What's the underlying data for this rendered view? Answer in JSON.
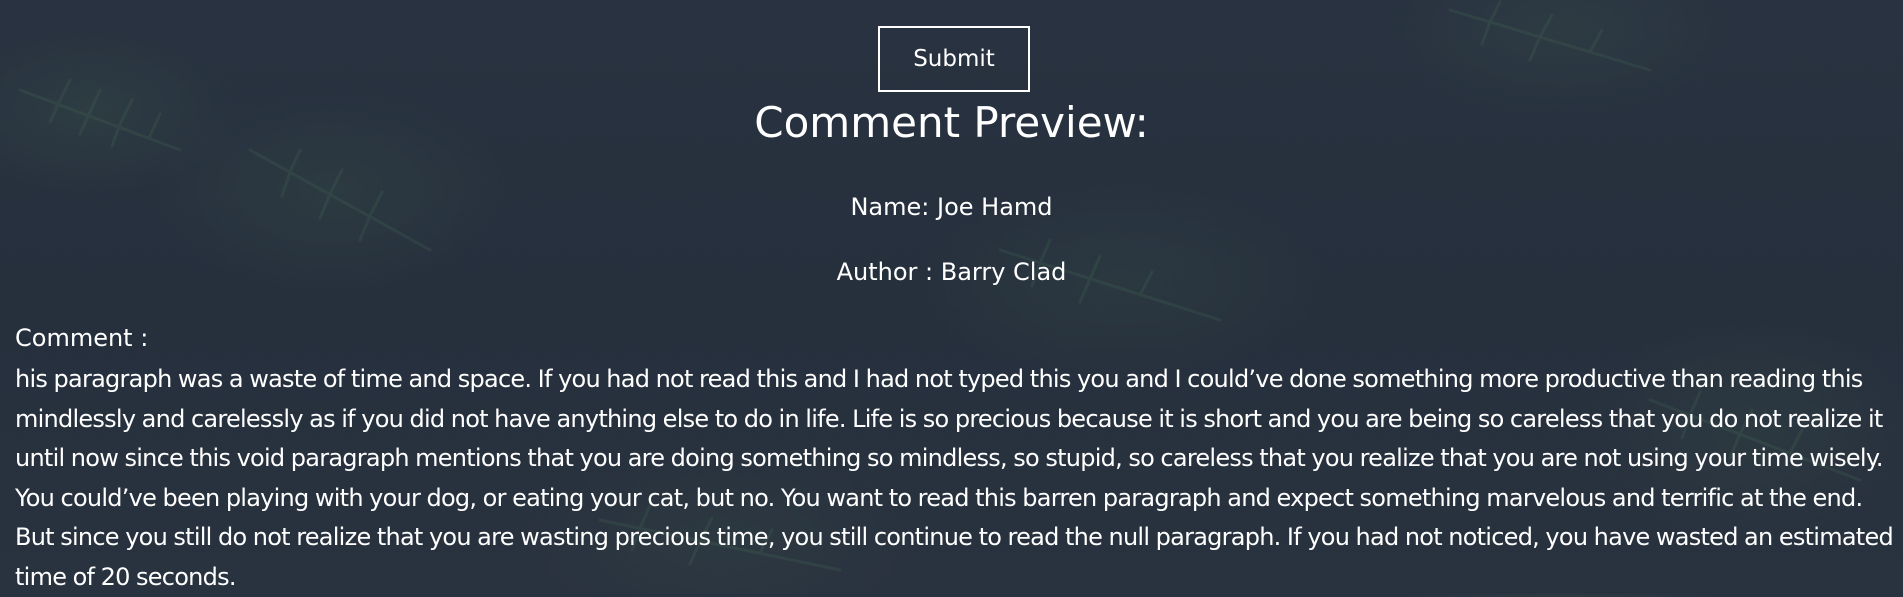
{
  "form": {
    "submit_label": "Submit"
  },
  "preview": {
    "title": "Comment Preview:",
    "name_line": "Name: Joe Hamd",
    "author_line": "Author : Barry Clad",
    "comment_label": "Comment :",
    "comment_text": "his paragraph was a waste of time and space. If you had not read this and I had not typed this you and I could’ve done something more productive than reading this mindlessly and carelessly as if you did not have anything else to do in life. Life is so precious because it is short and you are being so careless that you do not realize it until now since this void paragraph mentions that you are doing something so mindless, so stupid, so careless that you realize that you are not using your time wisely. You could’ve been playing with your dog, or eating your cat, but no. You want to read this barren paragraph and expect something marvelous and terrific at the end. But since you still do not realize that you are wasting precious time, you still continue to read the null paragraph. If you had not noticed, you have wasted an estimated time of 20 seconds."
  },
  "theme": {
    "background": "#27303d",
    "text": "#ffffff",
    "foliage": "#3d5a4a"
  }
}
